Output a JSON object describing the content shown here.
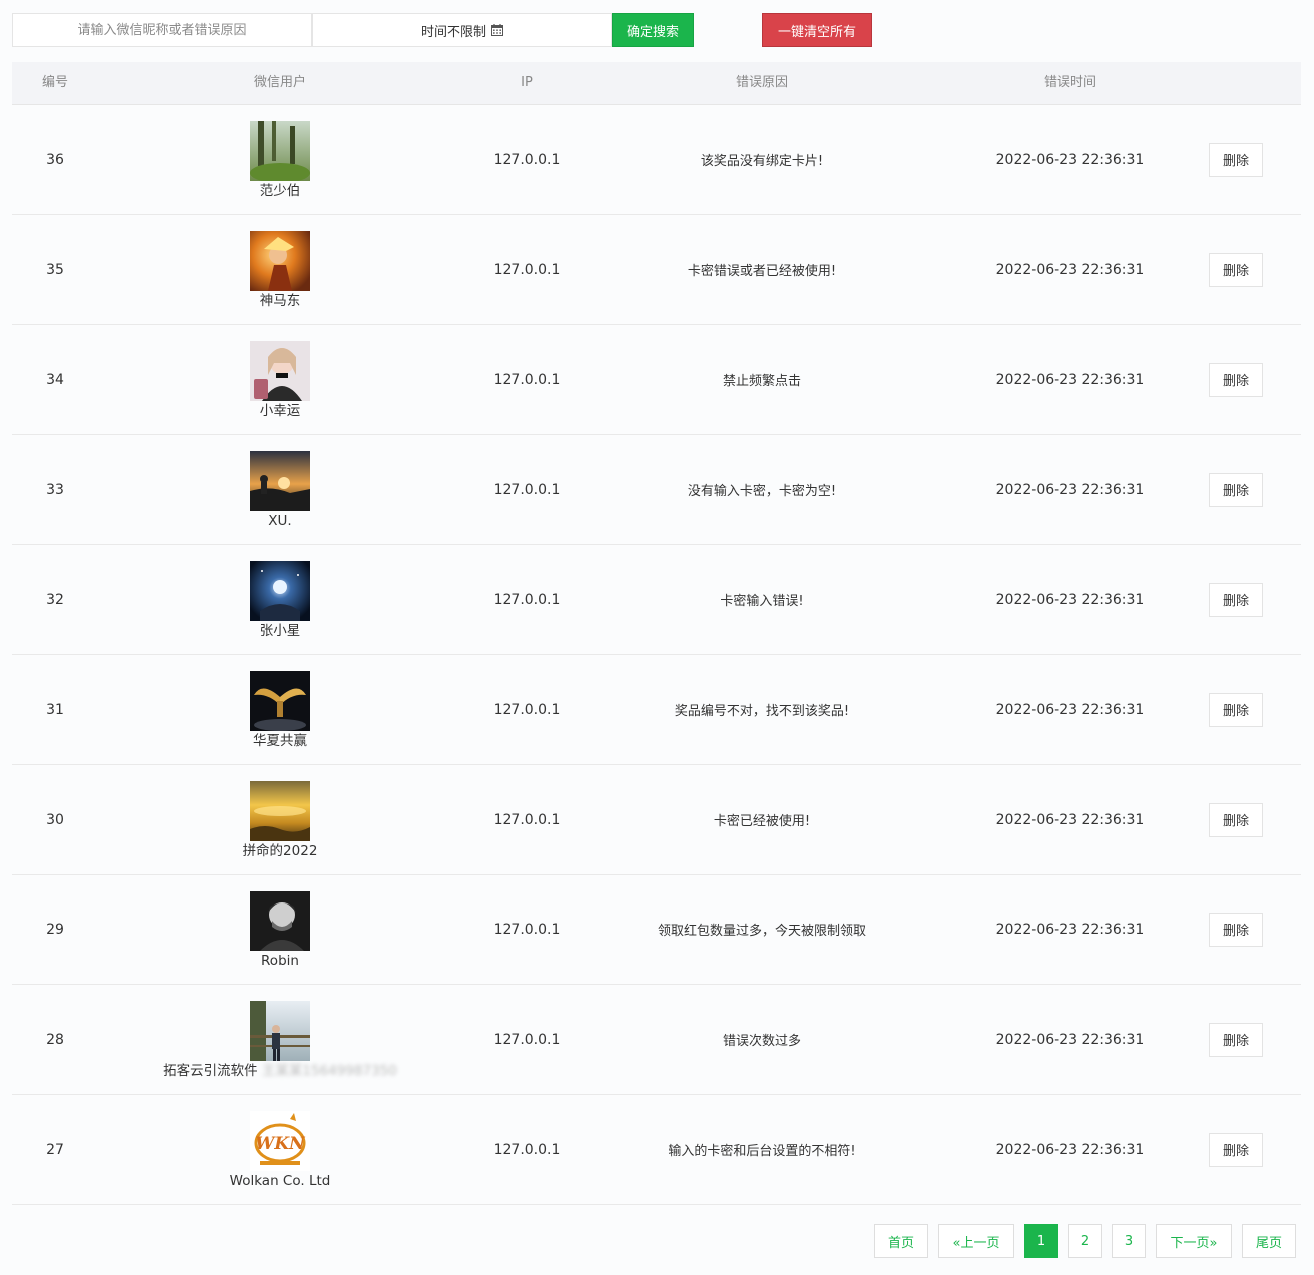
{
  "toolbar": {
    "search_placeholder": "请输入微信昵称或者错误原因",
    "time_filter_label": "时间不限制",
    "search_button": "确定搜索",
    "clear_button": "一键清空所有",
    "colors": {
      "search": "#1bb54c",
      "clear": "#d9434a"
    }
  },
  "table": {
    "headers": {
      "id": "编号",
      "user": "微信用户",
      "ip": "IP",
      "reason": "错误原因",
      "time": "错误时间"
    },
    "delete_label": "删除",
    "rows": [
      {
        "id": "36",
        "nickname": "范少伯",
        "ip": "127.0.0.1",
        "reason": "该奖品没有绑定卡片!",
        "time": "2022-06-23 22:36:31",
        "avatar": "park-photo"
      },
      {
        "id": "35",
        "nickname": "神马东",
        "ip": "127.0.0.1",
        "reason": "卡密错误或者已经被使用!",
        "time": "2022-06-23 22:36:31",
        "avatar": "fire-warrior"
      },
      {
        "id": "34",
        "nickname": "小幸运",
        "ip": "127.0.0.1",
        "reason": "禁止频繁点击",
        "time": "2022-06-23 22:36:31",
        "avatar": "girl-portrait"
      },
      {
        "id": "33",
        "nickname": "XU.",
        "ip": "127.0.0.1",
        "reason": "没有输入卡密，卡密为空!",
        "time": "2022-06-23 22:36:31",
        "avatar": "sunset"
      },
      {
        "id": "32",
        "nickname": "张小星",
        "ip": "127.0.0.1",
        "reason": "卡密输入错误!",
        "time": "2022-06-23 22:36:31",
        "avatar": "galaxy-hand"
      },
      {
        "id": "31",
        "nickname": "华夏共赢",
        "ip": "127.0.0.1",
        "reason": "奖品编号不对，找不到该奖品!",
        "time": "2022-06-23 22:36:31",
        "avatar": "golden-wings"
      },
      {
        "id": "30",
        "nickname": "拼命的2022",
        "ip": "127.0.0.1",
        "reason": "卡密已经被使用!",
        "time": "2022-06-23 22:36:31",
        "avatar": "golden-clouds"
      },
      {
        "id": "29",
        "nickname": "Robin",
        "ip": "127.0.0.1",
        "reason": "领取红包数量过多，今天被限制领取",
        "time": "2022-06-23 22:36:31",
        "avatar": "man-bw"
      },
      {
        "id": "28",
        "nickname": "拓客云引流软件",
        "nickname_blurred": "王某某15649987350",
        "ip": "127.0.0.1",
        "reason": "错误次数过多",
        "time": "2022-06-23 22:36:31",
        "avatar": "man-lake"
      },
      {
        "id": "27",
        "nickname": "Wolkan Co. Ltd",
        "ip": "127.0.0.1",
        "reason": "输入的卡密和后台设置的不相符!",
        "time": "2022-06-23 22:36:31",
        "avatar": "wkn-logo"
      }
    ]
  },
  "pagination": {
    "first": "首页",
    "prev": "«上一页",
    "pages": [
      "1",
      "2",
      "3"
    ],
    "current": "1",
    "next": "下一页»",
    "last": "尾页"
  }
}
